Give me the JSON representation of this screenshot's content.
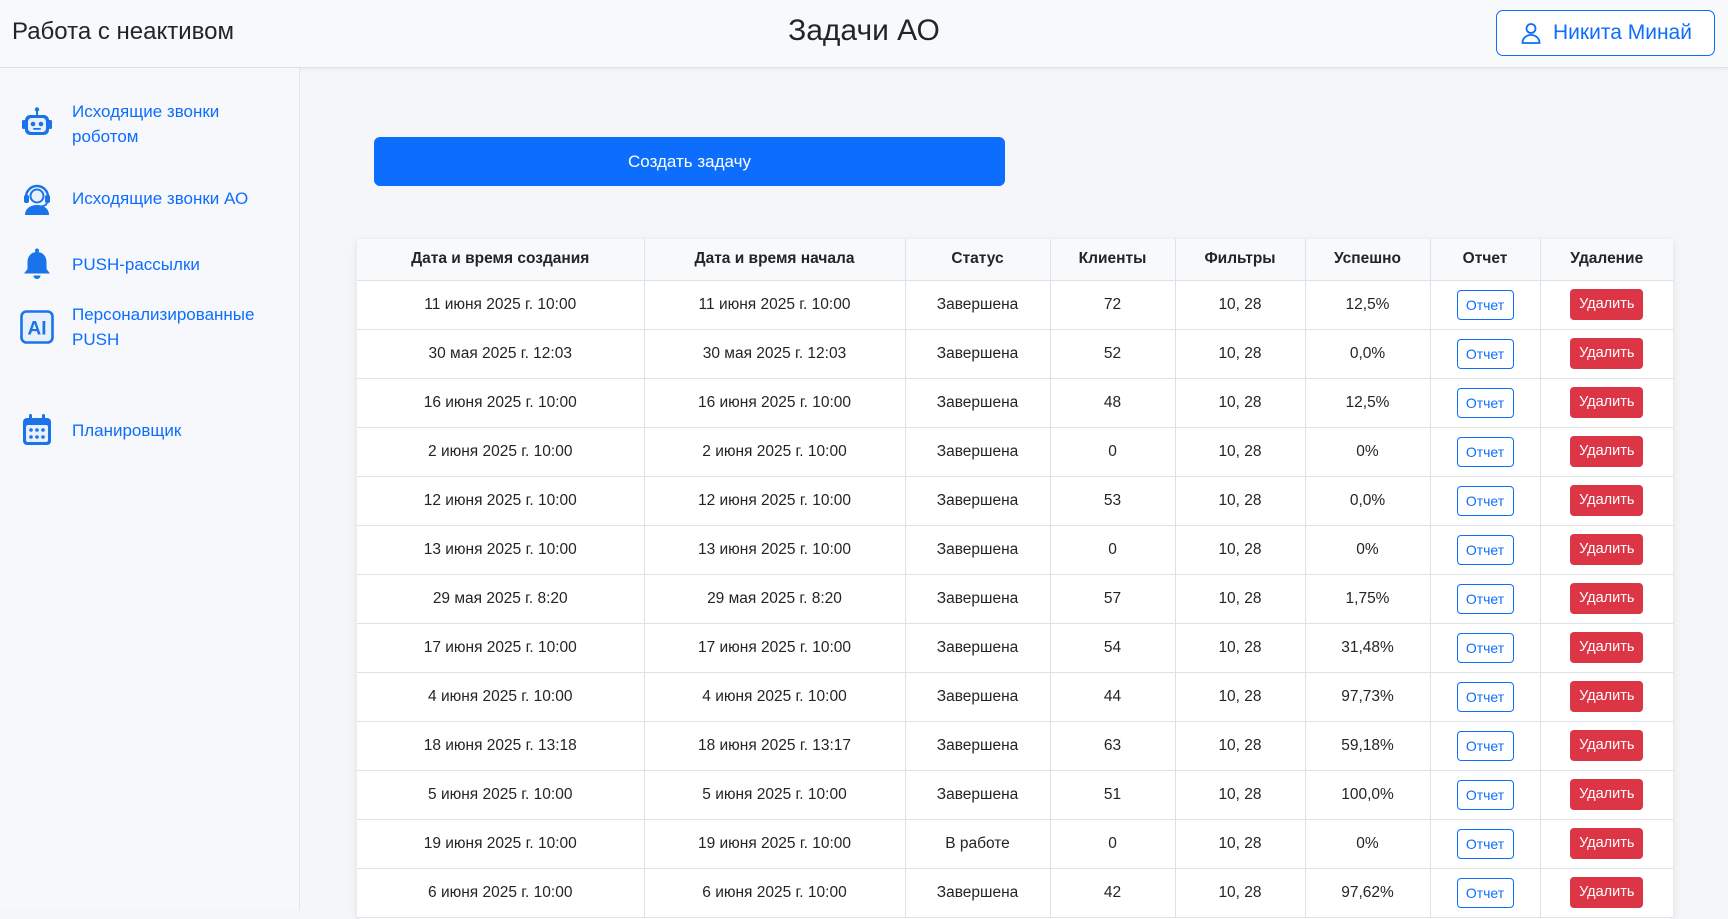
{
  "header": {
    "app_title": "Работа с неактивом",
    "page_title": "Задачи АО",
    "user_name": "Никита Минай"
  },
  "sidebar": {
    "items": [
      {
        "label": "Исходящие звонки роботом",
        "icon": "robot-icon"
      },
      {
        "label": "Исходящие звонки АО",
        "icon": "operator-headset-icon"
      },
      {
        "label": "PUSH-рассылки",
        "icon": "bell-icon"
      },
      {
        "label": "Персонализированные PUSH",
        "icon": "ai-icon"
      },
      {
        "label": "Планировщик",
        "icon": "calendar-icon"
      }
    ]
  },
  "main": {
    "create_button": "Создать задачу",
    "table": {
      "columns": [
        "Дата и время создания",
        "Дата и время начала",
        "Статус",
        "Клиенты",
        "Фильтры",
        "Успешно",
        "Отчет",
        "Удаление"
      ],
      "report_label": "Отчет",
      "delete_label": "Удалить",
      "rows": [
        {
          "created": "11 июня 2025 г. 10:00",
          "started": "11 июня 2025 г. 10:00",
          "status": "Завершена",
          "clients": "72",
          "filters": "10, 28",
          "success": "12,5%"
        },
        {
          "created": "30 мая 2025 г. 12:03",
          "started": "30 мая 2025 г. 12:03",
          "status": "Завершена",
          "clients": "52",
          "filters": "10, 28",
          "success": "0,0%"
        },
        {
          "created": "16 июня 2025 г. 10:00",
          "started": "16 июня 2025 г. 10:00",
          "status": "Завершена",
          "clients": "48",
          "filters": "10, 28",
          "success": "12,5%"
        },
        {
          "created": "2 июня 2025 г. 10:00",
          "started": "2 июня 2025 г. 10:00",
          "status": "Завершена",
          "clients": "0",
          "filters": "10, 28",
          "success": "0%"
        },
        {
          "created": "12 июня 2025 г. 10:00",
          "started": "12 июня 2025 г. 10:00",
          "status": "Завершена",
          "clients": "53",
          "filters": "10, 28",
          "success": "0,0%"
        },
        {
          "created": "13 июня 2025 г. 10:00",
          "started": "13 июня 2025 г. 10:00",
          "status": "Завершена",
          "clients": "0",
          "filters": "10, 28",
          "success": "0%"
        },
        {
          "created": "29 мая 2025 г. 8:20",
          "started": "29 мая 2025 г. 8:20",
          "status": "Завершена",
          "clients": "57",
          "filters": "10, 28",
          "success": "1,75%"
        },
        {
          "created": "17 июня 2025 г. 10:00",
          "started": "17 июня 2025 г. 10:00",
          "status": "Завершена",
          "clients": "54",
          "filters": "10, 28",
          "success": "31,48%"
        },
        {
          "created": "4 июня 2025 г. 10:00",
          "started": "4 июня 2025 г. 10:00",
          "status": "Завершена",
          "clients": "44",
          "filters": "10, 28",
          "success": "97,73%"
        },
        {
          "created": "18 июня 2025 г. 13:18",
          "started": "18 июня 2025 г. 13:17",
          "status": "Завершена",
          "clients": "63",
          "filters": "10, 28",
          "success": "59,18%"
        },
        {
          "created": "5 июня 2025 г. 10:00",
          "started": "5 июня 2025 г. 10:00",
          "status": "Завершена",
          "clients": "51",
          "filters": "10, 28",
          "success": "100,0%"
        },
        {
          "created": "19 июня 2025 г. 10:00",
          "started": "19 июня 2025 г. 10:00",
          "status": "В работе",
          "clients": "0",
          "filters": "10, 28",
          "success": "0%"
        },
        {
          "created": "6 июня 2025 г. 10:00",
          "started": "6 июня 2025 г. 10:00",
          "status": "Завершена",
          "clients": "42",
          "filters": "10, 28",
          "success": "97,62%"
        }
      ]
    }
  },
  "colors": {
    "primary": "#0d6efd",
    "danger": "#dc3545",
    "background": "#f4f6f9"
  }
}
